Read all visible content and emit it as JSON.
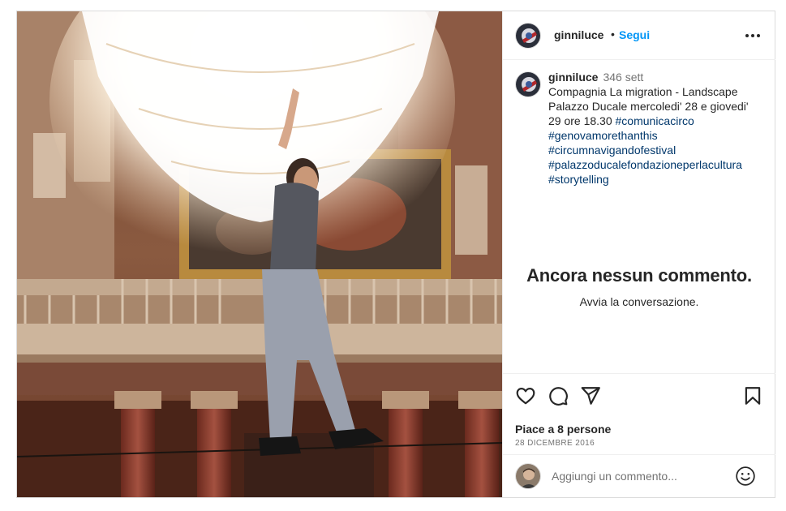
{
  "post": {
    "username": "ginniluce",
    "follow_label": "Segui",
    "separator": "•",
    "more_icon": "more-horizontal-icon"
  },
  "caption": {
    "username": "ginniluce",
    "time": "346 sett",
    "lines": [
      "Compagnia La migration - Landscape",
      "Palazzo Ducale mercoledi' 28 e giovedi'",
      "29 ore 18.30"
    ],
    "hashtags": [
      "#comunicacirco",
      "#genovamorethanthis",
      "#circumnavigandofestival",
      "#palazzoducalefondazioneperlacultura",
      "#storytelling"
    ]
  },
  "comments": {
    "empty_title": "Ancora nessun commento.",
    "empty_subtitle": "Avvia la conversazione."
  },
  "actions": {
    "icons": [
      "heart-icon",
      "comment-icon",
      "share-icon",
      "bookmark-icon"
    ],
    "likes": "Piace a 8 persone",
    "date": "28 DICEMBRE 2016"
  },
  "comment_box": {
    "placeholder": "Aggiungi un commento...",
    "emoji_icon": "emoji-icon"
  },
  "colors": {
    "link_blue": "#0095f6",
    "hashtag_blue": "#00376b",
    "secondary_text": "#737373",
    "border": "#dbdbdb"
  }
}
